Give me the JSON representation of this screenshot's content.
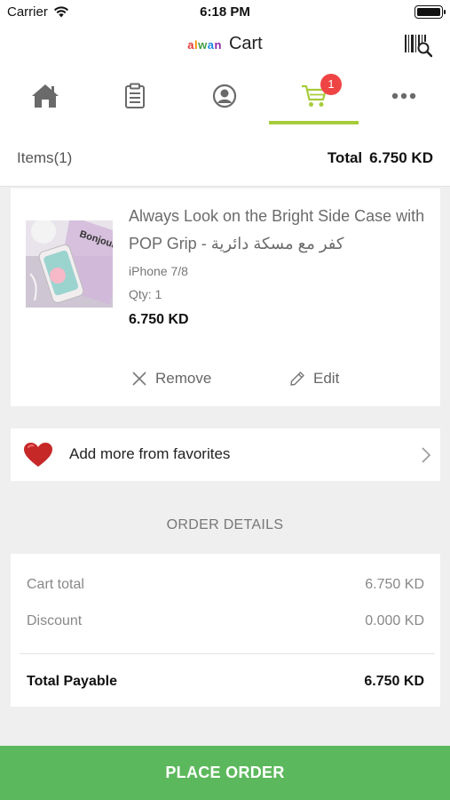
{
  "status_bar": {
    "carrier": "Carrier",
    "time": "6:18 PM"
  },
  "nav": {
    "logo": "alwan",
    "title": "Cart"
  },
  "tabs": [
    {
      "name": "home-icon"
    },
    {
      "name": "clipboard-icon"
    },
    {
      "name": "profile-icon"
    },
    {
      "name": "cart-icon",
      "badge": "1",
      "active": true
    },
    {
      "name": "more-icon"
    }
  ],
  "summary": {
    "items_label": "Items",
    "items_count": "(1)",
    "total_label": "Total",
    "total_value": "6.750 KD"
  },
  "product": {
    "name": "Always Look on the Bright Side Case with POP Grip - كفر مع مسكة دائرية",
    "variant": "iPhone 7/8",
    "qty": "Qty: 1",
    "price": "6.750 KD",
    "remove_label": "Remove",
    "edit_label": "Edit",
    "image_text": "Bonjour"
  },
  "favorites": {
    "label": "Add more from favorites"
  },
  "order_details": {
    "heading": "ORDER DETAILS",
    "cart_total_label": "Cart total",
    "cart_total_value": "6.750 KD",
    "discount_label": "Discount",
    "discount_value": "0.000 KD",
    "payable_label": "Total Payable",
    "payable_value": "6.750 KD"
  },
  "place_order_label": "PLACE ORDER",
  "colors": {
    "accent": "#a6cc3a",
    "badge": "#ef4444",
    "cta": "#5cb85c",
    "heart": "#c62828"
  }
}
